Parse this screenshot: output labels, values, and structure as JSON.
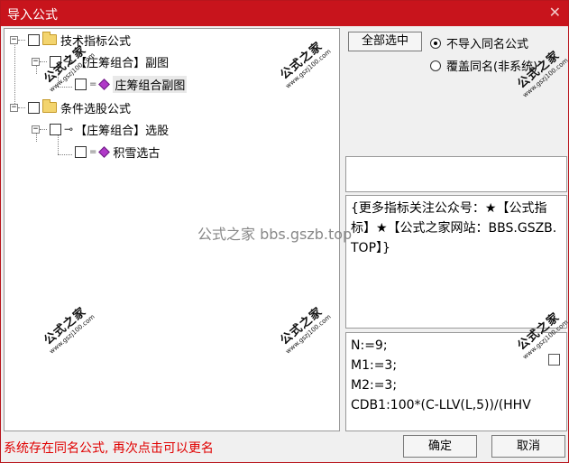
{
  "window": {
    "title": "导入公式",
    "close_glyph": "✕"
  },
  "tree": {
    "root1_label": "技术指标公式",
    "root1_child_label": "【庄筹组合】副图",
    "root1_leaf_label": "庄筹组合副图",
    "root2_label": "条件选股公式",
    "root2_child_label": "【庄筹组合】选股",
    "root2_leaf_label": "积雪选古"
  },
  "options": {
    "select_all_label": "全部选中",
    "radio_skip_label": "不导入同名公式",
    "radio_overwrite_label": "覆盖同名(非系统)"
  },
  "info": {
    "text": "{更多指标关注公众号：★【公式指标】★【公式之家网站：BBS.GSZB.TOP】}"
  },
  "code": {
    "lines": [
      "N:=9;",
      "M1:=3;",
      "M2:=3;",
      "CDB1:100*(C-LLV(L,5))/(HHV"
    ]
  },
  "footer": {
    "status": "系统存在同名公式, 再次点击可以更名",
    "confirm_label": "确定",
    "cancel_label": "取消"
  },
  "watermark": {
    "big": "公式之家",
    "small": "www.gszj100.com",
    "center": "公式之家 bbs.gszb.top"
  },
  "colors": {
    "titlebar": "#c8141c",
    "status_text": "#e00000",
    "leaf_icon": "#b039c8"
  }
}
